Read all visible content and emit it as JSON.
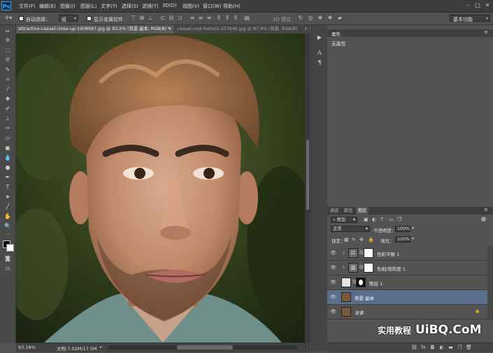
{
  "app": {
    "logo": "Ps"
  },
  "menu": [
    "文件(F)",
    "编辑(E)",
    "图像(I)",
    "图层(L)",
    "文字(Y)",
    "选择(S)",
    "滤镜(T)",
    "3D(D)",
    "视图(V)",
    "窗口(W)",
    "帮助(H)"
  ],
  "window_controls": {
    "minimize": "–",
    "maximize": "□",
    "close": "✕"
  },
  "options": {
    "auto_select_label": "自动选择：",
    "auto_select_value": "组",
    "show_transform_label": "显示变换控件",
    "mode_3d_label": "3D 模式：",
    "workspace": "基本功能"
  },
  "tabs": [
    {
      "label": "attractive-casual-close-up-1906997.jpg @ 93.2% (背景 副本, RGB/8) *",
      "close": "×"
    },
    {
      "label": "casual-cool-fashion-157646.jpg @ 87.9% (背景, RGB/8) ",
      "close": "×"
    }
  ],
  "status": {
    "zoom": "93.16%",
    "doc": "文档:7.02M/17.5M"
  },
  "properties": {
    "title": "属性",
    "empty_text": "无属性"
  },
  "layers_panel": {
    "tabs": [
      "通道",
      "路径",
      "图层"
    ],
    "filter_label": "类型",
    "blend_mode": "正常",
    "opacity_label": "不透明度：",
    "opacity_value": "100%",
    "lock_label": "锁定：",
    "fill_label": "填充：",
    "fill_value": "100%",
    "layers": [
      {
        "name": "色彩平衡 1",
        "type": "adjustment"
      },
      {
        "name": "色相/饱和度 1",
        "type": "adjustment"
      },
      {
        "name": "图层 1",
        "type": "masked"
      },
      {
        "name": "背景 副本",
        "type": "photo",
        "selected": true
      },
      {
        "name": "背景",
        "type": "photo",
        "locked": true
      }
    ]
  },
  "watermark": "UiBQ.CoM",
  "watermark_cn": "实用教程",
  "colors": {
    "accent": "#31a8ff",
    "selected_layer": "#5a6f8c",
    "panel": "#535353"
  }
}
